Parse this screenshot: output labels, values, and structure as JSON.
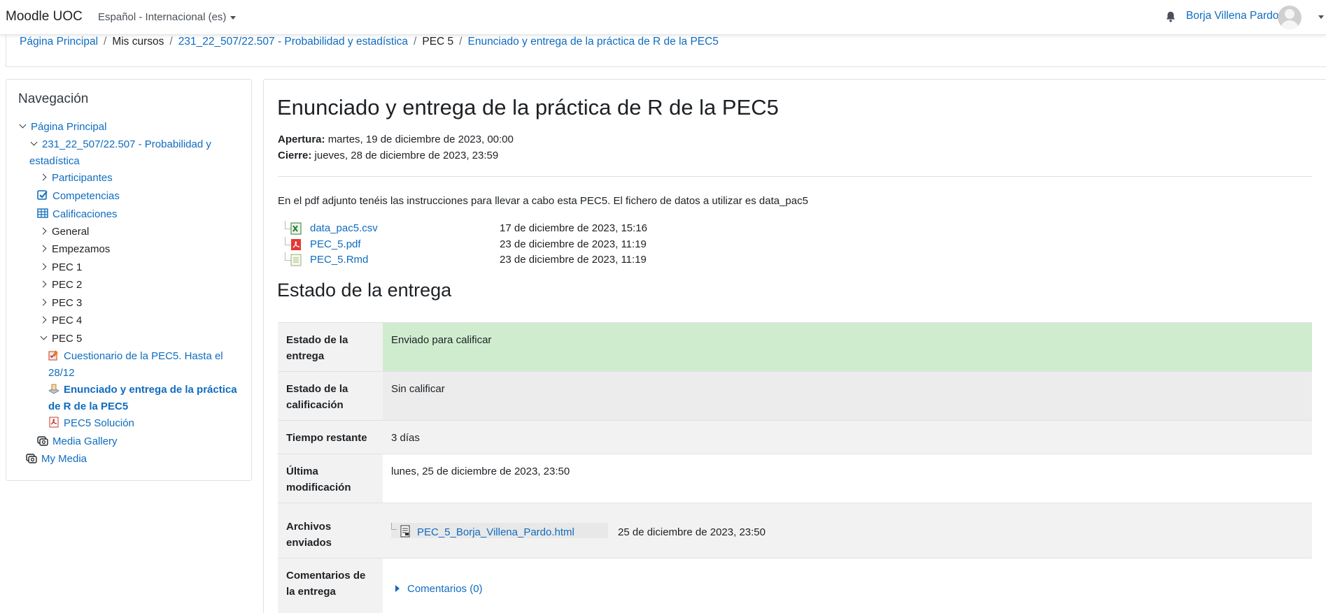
{
  "navbar": {
    "brand": "Moodle UOC",
    "language": "Español - Internacional (es)",
    "user_name": "Borja Villena Pardo"
  },
  "breadcrumb": [
    "Página Principal",
    "Mis cursos",
    "231_22_507/22.507 - Probabilidad y estadística",
    "PEC 5",
    "Enunciado y entrega de la práctica de R de la PEC5"
  ],
  "navigation": {
    "heading": "Navegación",
    "home": "Página Principal",
    "course_line1": "231_22_507/22.507 - Probabilidad y",
    "course_line2": "estadística",
    "participants": "Participantes",
    "competencies": "Competencias",
    "grades": "Calificaciones",
    "general": "General",
    "start": "Empezamos",
    "pec1": "PEC 1",
    "pec2": "PEC 2",
    "pec3": "PEC 3",
    "pec4": "PEC 4",
    "pec5": "PEC 5",
    "quiz_line1": "Cuestionario de la PEC5. Hasta el",
    "quiz_line2": "28/12",
    "assign_line1": "Enunciado y entrega de la práctica",
    "assign_line2": "de R de la PEC5",
    "solution": "PEC5 Solución",
    "media_gallery": "Media Gallery",
    "my_media": "My Media"
  },
  "page": {
    "title": "Enunciado y entrega de la práctica de R de la PEC5",
    "opening_label": "Apertura:",
    "opening_value": "martes, 19 de diciembre de 2023, 00:00",
    "closing_label": "Cierre:",
    "closing_value": "jueves, 28 de diciembre de 2023, 23:59",
    "intro": "En el pdf adjunto tenéis las instrucciones para llevar a cabo esta PEC5. El fichero de datos a utilizar es data_pac5",
    "files": [
      {
        "name": "data_pac5.csv",
        "date": "17 de diciembre de 2023, 15:16",
        "icon": "spreadsheet-icon"
      },
      {
        "name": "PEC_5.pdf",
        "date": "23 de diciembre de 2023, 11:19",
        "icon": "pdf-icon"
      },
      {
        "name": "PEC_5.Rmd",
        "date": "23 de diciembre de 2023, 11:19",
        "icon": "text-file-icon"
      }
    ],
    "status_heading": "Estado de la entrega"
  },
  "status": {
    "submission_label": "Estado de la entrega",
    "submission_value": "Enviado para calificar",
    "grading_label": "Estado de la calificación",
    "grading_value": "Sin calificar",
    "time_label": "Tiempo restante",
    "time_value": "3 días",
    "modified_label": "Última modificación",
    "modified_value": "lunes, 25 de diciembre de 2023, 23:50",
    "files_label": "Archivos enviados",
    "submitted_file": "PEC_5_Borja_Villena_Pardo.html",
    "submitted_file_date": "25 de diciembre de 2023, 23:50",
    "comments_label": "Comentarios de la entrega",
    "comments_link": "Comentarios (0)"
  },
  "colors": {
    "link": "#0f6cbf",
    "submitted_green": "#cfeccf"
  }
}
